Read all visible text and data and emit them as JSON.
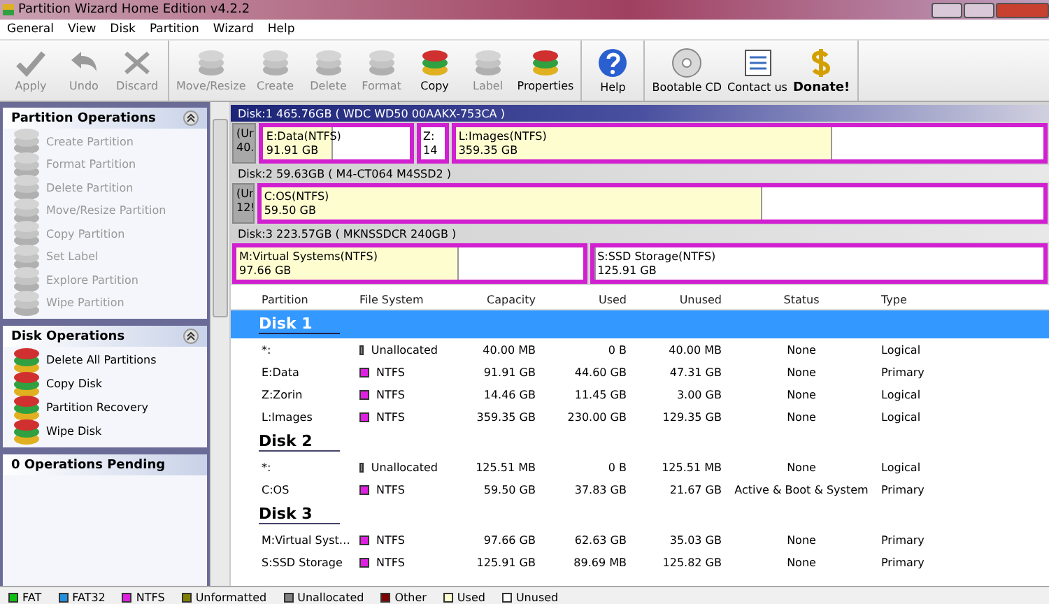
{
  "window": {
    "title": "Partition Wizard Home Edition v4.2.2"
  },
  "menu": [
    "General",
    "View",
    "Disk",
    "Partition",
    "Wizard",
    "Help"
  ],
  "toolbar": [
    [
      {
        "label": "Apply",
        "disabled": true
      },
      {
        "label": "Undo",
        "disabled": true
      },
      {
        "label": "Discard",
        "disabled": true
      }
    ],
    [
      {
        "label": "Move/Resize",
        "disabled": true
      },
      {
        "label": "Create",
        "disabled": true
      },
      {
        "label": "Delete",
        "disabled": true
      },
      {
        "label": "Format",
        "disabled": true
      },
      {
        "label": "Copy",
        "disabled": false
      },
      {
        "label": "Label",
        "disabled": true
      },
      {
        "label": "Properties",
        "disabled": false
      }
    ],
    [
      {
        "label": "Help",
        "disabled": false
      }
    ],
    [
      {
        "label": "Bootable CD",
        "disabled": false
      },
      {
        "label": "Contact us",
        "disabled": false
      },
      {
        "label": "Donate!",
        "disabled": false
      }
    ]
  ],
  "sidebar": [
    {
      "title": "Partition Operations",
      "collapsible": true,
      "items": [
        {
          "label": "Create Partition",
          "disabled": true
        },
        {
          "label": "Format Partition",
          "disabled": true
        },
        {
          "label": "Delete Partition",
          "disabled": true
        },
        {
          "label": "Move/Resize Partition",
          "disabled": true
        },
        {
          "label": "Copy Partition",
          "disabled": true
        },
        {
          "label": "Set Label",
          "disabled": true
        },
        {
          "label": "Explore Partition",
          "disabled": true
        },
        {
          "label": "Wipe Partition",
          "disabled": true
        }
      ]
    },
    {
      "title": "Disk Operations",
      "collapsible": true,
      "items": [
        {
          "label": "Delete All Partitions",
          "disabled": false
        },
        {
          "label": "Copy Disk",
          "disabled": false
        },
        {
          "label": "Partition Recovery",
          "disabled": false
        },
        {
          "label": "Wipe Disk",
          "disabled": false
        }
      ]
    },
    {
      "title": "0 Operations Pending",
      "collapsible": false
    }
  ],
  "disk_map": [
    {
      "header": "Disk:1 465.76GB  ( WDC WD50 00AAKX-753CA )",
      "selected": true,
      "partitions": [
        {
          "kind": "unallocated",
          "name": "(Ur",
          "size": "40."
        },
        {
          "kind": "ntfs",
          "name": "E:Data(NTFS)",
          "size": "91.91 GB",
          "level": 0.48
        },
        {
          "kind": "ntfs",
          "name": "Z:",
          "size": "14"
        },
        {
          "kind": "ntfs",
          "name": "L:Images(NTFS)",
          "size": "359.35 GB",
          "level": 0.64
        }
      ]
    },
    {
      "header": "Disk:2 59.63GB  ( M4-CT064 M4SSD2 )",
      "selected": false,
      "partitions": [
        {
          "kind": "unallocated",
          "name": "(Ur",
          "size": "12!"
        },
        {
          "kind": "ntfs",
          "name": "C:OS(NTFS)",
          "size": "59.50 GB",
          "level": 0.64
        }
      ]
    },
    {
      "header": "Disk:3 223.57GB  ( MKNSSDCR 240GB )",
      "selected": false,
      "partitions": [
        {
          "kind": "ntfs",
          "name": "M:Virtual Systems(NTFS)",
          "size": "97.66 GB",
          "level": 0.64
        },
        {
          "kind": "ntfs",
          "name": "S:SSD Storage(NTFS)",
          "size": "125.91 GB",
          "level": 0
        }
      ]
    }
  ],
  "table": {
    "columns": [
      "Partition",
      "File System",
      "Capacity",
      "Used",
      "Unused",
      "Status",
      "Type"
    ],
    "groups": [
      {
        "disk": "Disk 1",
        "selected": true,
        "rows": [
          {
            "partition": "*:",
            "file_system": "Unallocated",
            "color": "#808080",
            "capacity": "40.00 MB",
            "used": "0 B",
            "unused": "40.00 MB",
            "status": "None",
            "type": "Logical"
          },
          {
            "partition": "E:Data",
            "file_system": "NTFS",
            "color": "#e020e0",
            "capacity": "91.91 GB",
            "used": "44.60 GB",
            "unused": "47.31 GB",
            "status": "None",
            "type": "Primary"
          },
          {
            "partition": "Z:Zorin",
            "file_system": "NTFS",
            "color": "#e020e0",
            "capacity": "14.46 GB",
            "used": "11.45 GB",
            "unused": "3.00 GB",
            "status": "None",
            "type": "Logical"
          },
          {
            "partition": "L:Images",
            "file_system": "NTFS",
            "color": "#e020e0",
            "capacity": "359.35 GB",
            "used": "230.00 GB",
            "unused": "129.35 GB",
            "status": "None",
            "type": "Logical"
          }
        ]
      },
      {
        "disk": "Disk 2",
        "selected": false,
        "rows": [
          {
            "partition": "*:",
            "file_system": "Unallocated",
            "color": "#808080",
            "capacity": "125.51 MB",
            "used": "0 B",
            "unused": "125.51 MB",
            "status": "None",
            "type": "Logical"
          },
          {
            "partition": "C:OS",
            "file_system": "NTFS",
            "color": "#e020e0",
            "capacity": "59.50 GB",
            "used": "37.83 GB",
            "unused": "21.67 GB",
            "status": "Active & Boot & System",
            "type": "Primary"
          }
        ]
      },
      {
        "disk": "Disk 3",
        "selected": false,
        "rows": [
          {
            "partition": "M:Virtual Syst…",
            "file_system": "NTFS",
            "color": "#e020e0",
            "capacity": "97.66 GB",
            "used": "62.63 GB",
            "unused": "35.03 GB",
            "status": "None",
            "type": "Primary"
          },
          {
            "partition": "S:SSD Storage",
            "file_system": "NTFS",
            "color": "#e020e0",
            "capacity": "125.91 GB",
            "used": "89.69 MB",
            "unused": "125.82 GB",
            "status": "None",
            "type": "Primary"
          }
        ]
      }
    ]
  },
  "legend": [
    {
      "label": "FAT",
      "color": "#10c010"
    },
    {
      "label": "FAT32",
      "color": "#2090e0"
    },
    {
      "label": "NTFS",
      "color": "#e020e0"
    },
    {
      "label": "Unformatted",
      "color": "#808000"
    },
    {
      "label": "Unallocated",
      "color": "#808080"
    },
    {
      "label": "Other",
      "color": "#800000"
    },
    {
      "label": "Used",
      "color": "#ffffd0"
    },
    {
      "label": "Unused",
      "color": "#ffffff"
    }
  ]
}
